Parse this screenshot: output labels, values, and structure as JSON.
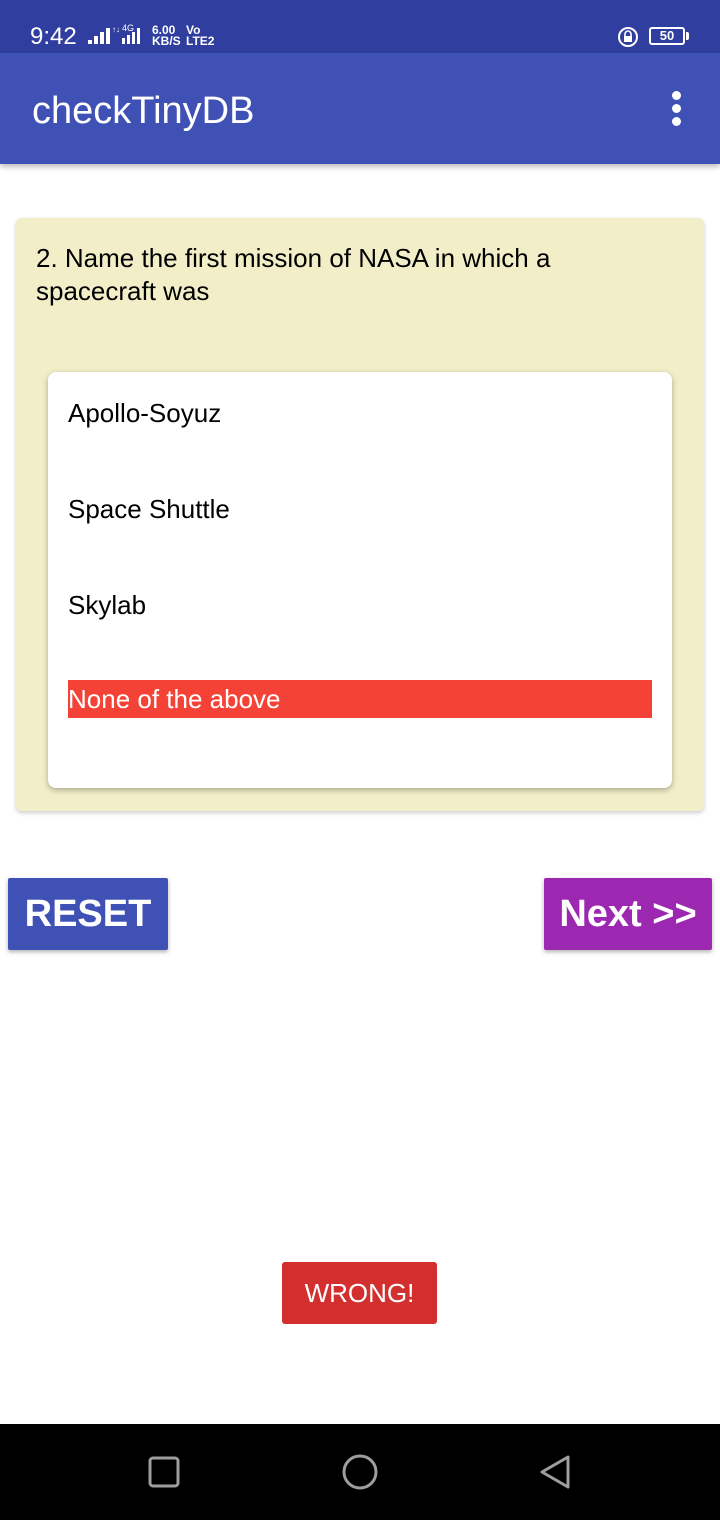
{
  "status_bar": {
    "time": "9:42",
    "network_label": "4G",
    "speed_value": "6.00",
    "speed_unit": "KB/S",
    "volte_top": "Vo",
    "volte_bottom": "LTE2",
    "battery": "50",
    "icons": [
      "signal-icon",
      "signal-4g-icon",
      "rotation-lock-icon",
      "battery-icon"
    ]
  },
  "app_bar": {
    "title": "checkTinyDB",
    "menu_icon": "more-vert-icon"
  },
  "question": {
    "text": "2. Name the first mission of NASA in which a spacecraft was",
    "options": [
      {
        "label": "Apollo-Soyuz",
        "selected": false
      },
      {
        "label": "Space Shuttle",
        "selected": false
      },
      {
        "label": "Skylab",
        "selected": false
      },
      {
        "label": "None of the above",
        "selected": true
      }
    ]
  },
  "buttons": {
    "reset_label": "RESET",
    "next_label": "Next >>"
  },
  "toast": {
    "text": "WRONG!"
  },
  "nav_bar": {
    "icons": [
      "recents-square-icon",
      "home-circle-icon",
      "back-triangle-icon"
    ]
  },
  "colors": {
    "status_bar": "#303f9f",
    "app_bar": "#3f51b5",
    "question_card": "#f2eec8",
    "selected_option": "#f44336",
    "reset_button": "#3f51b5",
    "next_button": "#9c27b0",
    "toast": "#d32f2f"
  }
}
